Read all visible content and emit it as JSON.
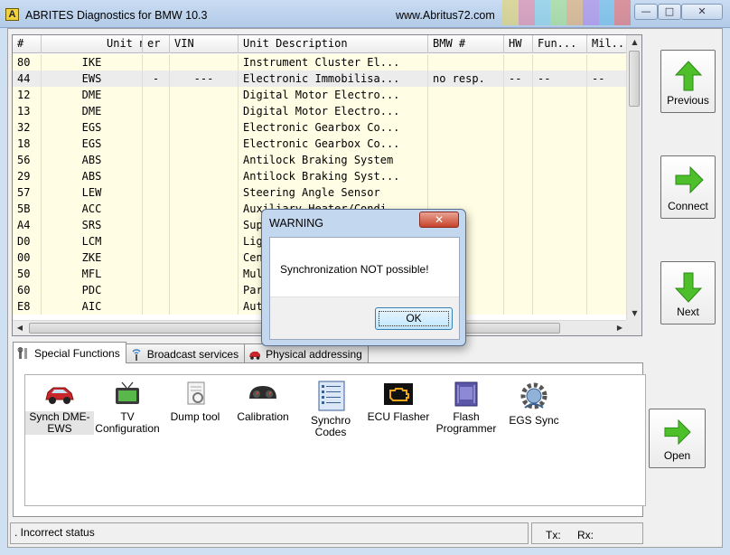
{
  "window": {
    "title": "ABRITES Diagnostics for BMW  10.3",
    "url": "www.Abritus72.com",
    "app_icon_letter": "A",
    "controls": {
      "minimize": "—",
      "maximize": "□",
      "close": "✕"
    }
  },
  "table": {
    "columns": [
      "#",
      "Unit name",
      "er",
      "VIN",
      "Unit Description",
      "BMW #",
      "HW",
      "Fun...",
      "Mil..."
    ],
    "rows": [
      [
        "80",
        "IKE",
        "",
        "",
        "Instrument Cluster El...",
        "",
        "",
        "",
        ""
      ],
      [
        "44",
        "EWS",
        "-",
        "---",
        "Electronic Immobilisa...",
        "no resp.",
        "--",
        "--",
        "--"
      ],
      [
        "12",
        "DME",
        "",
        "",
        "Digital Motor Electro...",
        "",
        "",
        "",
        ""
      ],
      [
        "13",
        "DME",
        "",
        "",
        "Digital Motor Electro...",
        "",
        "",
        "",
        ""
      ],
      [
        "32",
        "EGS",
        "",
        "",
        "Electronic Gearbox Co...",
        "",
        "",
        "",
        ""
      ],
      [
        "18",
        "EGS",
        "",
        "",
        "Electronic Gearbox Co...",
        "",
        "",
        "",
        ""
      ],
      [
        "56",
        "ABS",
        "",
        "",
        "Antilock Braking System",
        "",
        "",
        "",
        ""
      ],
      [
        "29",
        "ABS",
        "",
        "",
        "Antilock Braking Syst...",
        "",
        "",
        "",
        ""
      ],
      [
        "57",
        "LEW",
        "",
        "",
        "Steering Angle Sensor",
        "",
        "",
        "",
        ""
      ],
      [
        "5B",
        "ACC",
        "",
        "",
        "Auxiliary Heater/Condi",
        "",
        "",
        "",
        ""
      ],
      [
        "A4",
        "SRS",
        "",
        "",
        "Sup",
        "",
        "",
        "",
        ""
      ],
      [
        "D0",
        "LCM",
        "",
        "",
        "Lig",
        "",
        "",
        "",
        ""
      ],
      [
        "00",
        "ZKE",
        "",
        "",
        "Cen",
        "",
        "",
        "",
        ""
      ],
      [
        "50",
        "MFL",
        "",
        "",
        "Mul",
        "",
        "",
        "",
        ""
      ],
      [
        "60",
        "PDC",
        "",
        "",
        "Par",
        "",
        "",
        "",
        ""
      ],
      [
        "E8",
        "AIC",
        "",
        "",
        "Aut",
        "",
        "",
        "",
        ""
      ]
    ],
    "selected_row_index": 1
  },
  "nav_buttons": {
    "previous": "Previous",
    "connect": "Connect",
    "next": "Next",
    "open": "Open"
  },
  "tabs": [
    {
      "label": "Special Functions",
      "active": true
    },
    {
      "label": "Broadcast services",
      "active": false
    },
    {
      "label": "Physical addressing",
      "active": false
    }
  ],
  "tools": [
    {
      "label": "Synch DME-EWS",
      "icon": "car-icon"
    },
    {
      "label": "TV Configuration",
      "icon": "tv-icon"
    },
    {
      "label": "Dump tool",
      "icon": "dump-icon"
    },
    {
      "label": "Calibration",
      "icon": "gauge-icon"
    },
    {
      "label": "Synchro Codes",
      "icon": "list-icon"
    },
    {
      "label": "ECU Flasher",
      "icon": "engine-icon"
    },
    {
      "label": "Flash Programmer",
      "icon": "chip-icon"
    },
    {
      "label": "EGS Sync",
      "icon": "gear-sync-icon"
    }
  ],
  "status": {
    "message": ". Incorrect status",
    "tx": "Tx:",
    "rx": "Rx:"
  },
  "dialog": {
    "title": "WARNING",
    "message": "Synchronization NOT possible!",
    "ok_label": "OK",
    "close_glyph": "✕"
  },
  "colors": {
    "row_bg": "#fffde3",
    "selected_row_bg": "#ececec",
    "arrow_green": "#4cbf2a",
    "dialog_frame": "#c3d7ef"
  }
}
